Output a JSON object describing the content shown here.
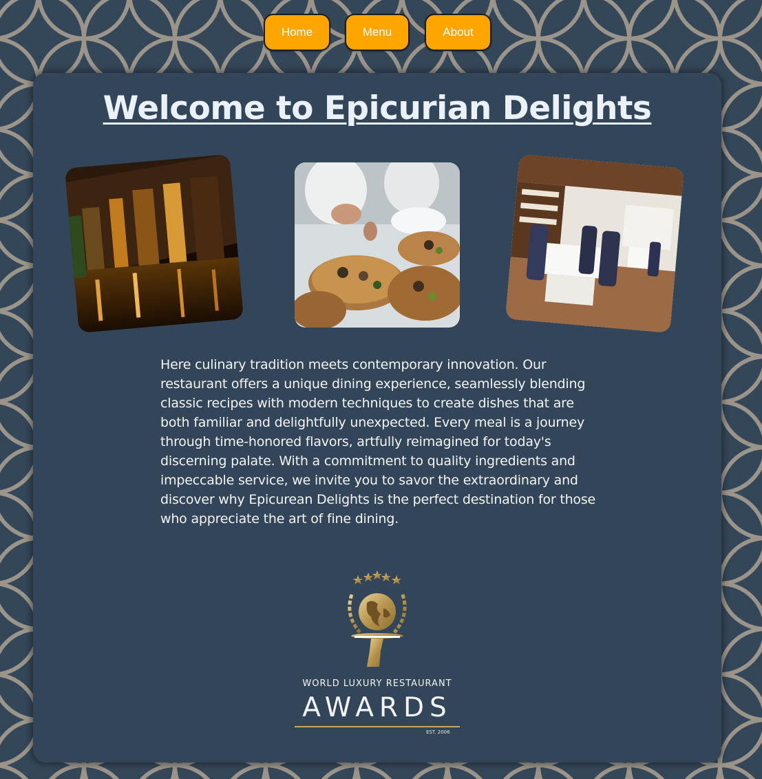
{
  "nav": {
    "items": [
      {
        "label": "Home"
      },
      {
        "label": "Menu"
      },
      {
        "label": "About"
      }
    ]
  },
  "main": {
    "title": "Welcome to Epicurian Delights",
    "description": "Here culinary tradition meets contemporary innovation. Our restaurant offers a unique dining experience, seamlessly blending classic recipes with modern techniques to create dishes that are both familiar and delightfully unexpected. Every meal is a journey through time-honored flavors, artfully reimagined for today's discerning palate. With a commitment to quality ingredients and impeccable service, we invite you to savor the extraordinary and discover why Epicurean Delights is the perfect destination for those who appreciate the art of fine dining."
  },
  "award": {
    "line1": "WORLD LUXURY RESTAURANT",
    "line2": "AWARDS",
    "est": "EST. 2006"
  },
  "colors": {
    "background": "#344758",
    "pattern_stroke": "#9a948a",
    "nav_button": "#ffa500",
    "panel": "#334659",
    "title": "#eaf1f8",
    "gold": "#c7a762"
  }
}
